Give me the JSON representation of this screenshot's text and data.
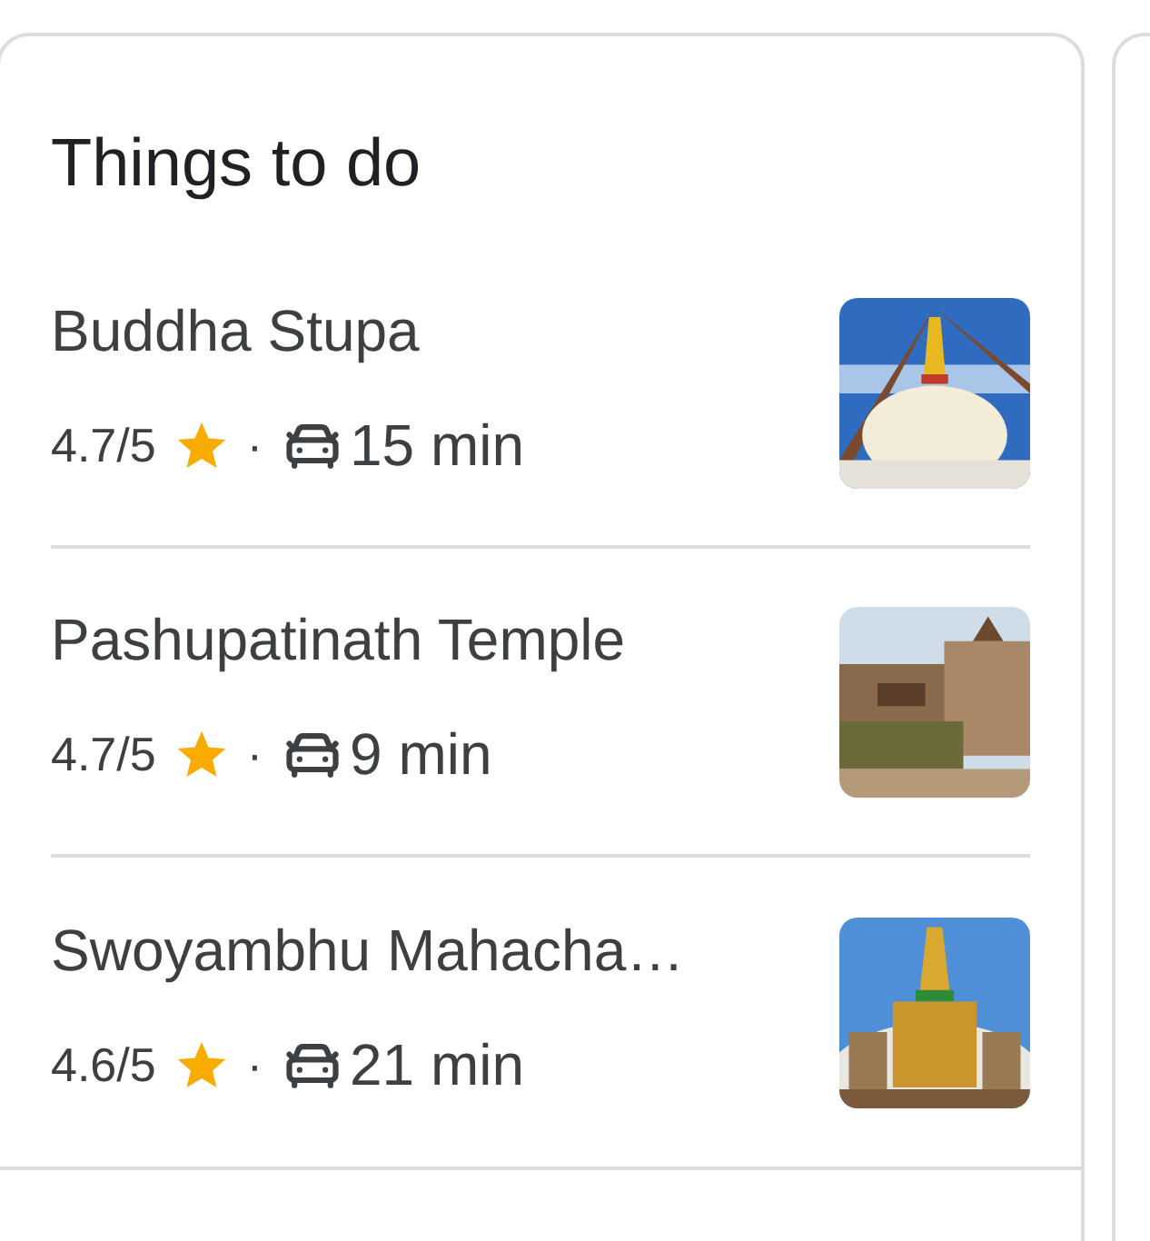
{
  "card": {
    "title": "Things to do",
    "items": [
      {
        "name": "Buddha Stupa",
        "rating": "4.7/5",
        "separator": "·",
        "drive_time": "15 min"
      },
      {
        "name": "Pashupatinath Temple",
        "rating": "4.7/5",
        "separator": "·",
        "drive_time": "9 min"
      },
      {
        "name": "Swoyambhu Mahacha…",
        "rating": "4.6/5",
        "separator": "·",
        "drive_time": "21 min"
      }
    ]
  }
}
